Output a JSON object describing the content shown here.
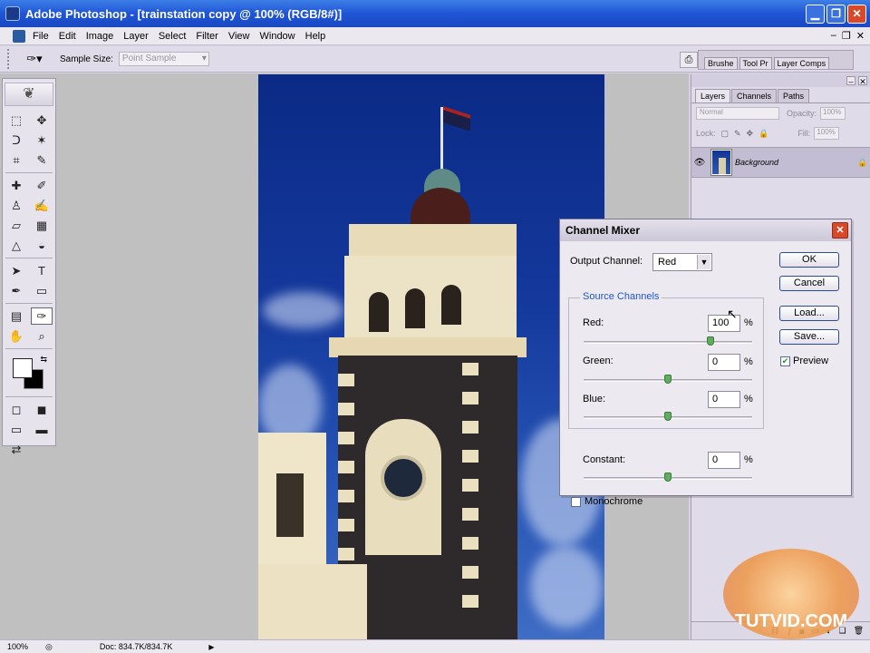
{
  "app": {
    "title": "Adobe Photoshop - [trainstation copy @ 100% (RGB/8#)]",
    "window_buttons": {
      "minimize": "▁",
      "restore": "❐",
      "close": "✕"
    }
  },
  "menu": {
    "items": [
      "File",
      "Edit",
      "Image",
      "Layer",
      "Select",
      "Filter",
      "View",
      "Window",
      "Help"
    ],
    "doc_buttons": [
      "–",
      "❐",
      "✕"
    ]
  },
  "options": {
    "sample_size_label": "Sample Size:",
    "sample_size_value": "Point Sample",
    "palette_well_tabs": [
      "Brushe",
      "Tool Pr",
      "Layer Comps"
    ]
  },
  "toolbox": {
    "tools": [
      {
        "name": "marquee-tool-icon",
        "glyph": "⬚"
      },
      {
        "name": "move-tool-icon",
        "glyph": "✥"
      },
      {
        "name": "lasso-tool-icon",
        "glyph": "ᑐ"
      },
      {
        "name": "magic-wand-icon",
        "glyph": "✶"
      },
      {
        "name": "crop-tool-icon",
        "glyph": "⌗"
      },
      {
        "name": "slice-tool-icon",
        "glyph": "✎"
      },
      {
        "name": "healing-brush-icon",
        "glyph": "✚"
      },
      {
        "name": "brush-tool-icon",
        "glyph": "✐"
      },
      {
        "name": "stamp-tool-icon",
        "glyph": "♙"
      },
      {
        "name": "history-brush-icon",
        "glyph": "✍"
      },
      {
        "name": "eraser-tool-icon",
        "glyph": "▱"
      },
      {
        "name": "gradient-tool-icon",
        "glyph": "▦"
      },
      {
        "name": "blur-tool-icon",
        "glyph": "△"
      },
      {
        "name": "dodge-tool-icon",
        "glyph": "◒"
      },
      {
        "name": "path-select-icon",
        "glyph": "➤"
      },
      {
        "name": "type-tool-icon",
        "glyph": "T"
      },
      {
        "name": "pen-tool-icon",
        "glyph": "✒"
      },
      {
        "name": "shape-tool-icon",
        "glyph": "▭"
      },
      {
        "name": "notes-tool-icon",
        "glyph": "▤"
      },
      {
        "name": "eyedropper-tool-icon",
        "glyph": "✑"
      },
      {
        "name": "hand-tool-icon",
        "glyph": "✋"
      },
      {
        "name": "zoom-tool-icon",
        "glyph": "⌕"
      }
    ]
  },
  "layers_panel": {
    "tabs": [
      "Layers",
      "Channels",
      "Paths"
    ],
    "blend_mode": "Normal",
    "opacity_label": "Opacity:",
    "opacity_value": "100%",
    "lock_label": "Lock:",
    "fill_label": "Fill:",
    "fill_value": "100%",
    "layer_name": "Background"
  },
  "status": {
    "zoom": "100%",
    "doc_info": "Doc: 834.7K/834.7K"
  },
  "watermark": "TUTVID.COM",
  "channel_mixer": {
    "title": "Channel Mixer",
    "output_channel_label": "Output Channel:",
    "output_channel_value": "Red",
    "source_channels_label": "Source Channels",
    "red_label": "Red:",
    "red_value": "100",
    "green_label": "Green:",
    "green_value": "0",
    "blue_label": "Blue:",
    "blue_value": "0",
    "constant_label": "Constant:",
    "constant_value": "0",
    "percent_sign": "%",
    "monochrome_label": "Monochrome",
    "monochrome_checked": false,
    "preview_label": "Preview",
    "preview_checked": true,
    "buttons": {
      "ok": "OK",
      "cancel": "Cancel",
      "load": "Load...",
      "save": "Save..."
    },
    "slider_levels": {
      "red": 100,
      "green": 0,
      "blue": 0,
      "constant": 0
    },
    "slider_range": [
      -200,
      200
    ]
  }
}
